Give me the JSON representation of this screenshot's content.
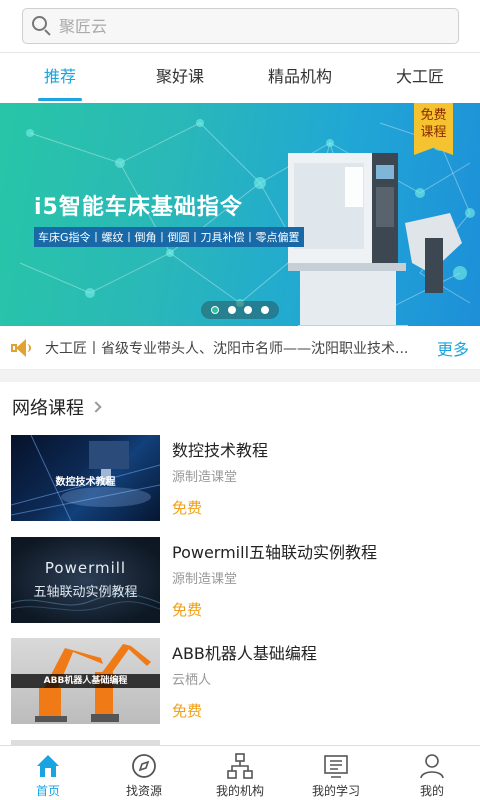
{
  "search": {
    "placeholder": "聚匠云"
  },
  "tabs": [
    {
      "label": "推荐",
      "active": true
    },
    {
      "label": "聚好课",
      "active": false
    },
    {
      "label": "精品机构",
      "active": false
    },
    {
      "label": "大工匠",
      "active": false
    }
  ],
  "banner": {
    "title": "i5智能车床基础指令",
    "subtitle": "车床G指令丨螺纹丨倒角丨倒圆丨刀具补偿丨零点偏置",
    "badge": "免费课程",
    "dots": 4,
    "active_dot": 0,
    "colors": {
      "start": "#28c6a7",
      "end": "#1e8fd8"
    }
  },
  "notice": {
    "icon": "speaker-icon",
    "text": "大工匠丨省级专业带头人、沈阳市名师——沈阳职业技术...",
    "more": "更多"
  },
  "section": {
    "title": "网络课程"
  },
  "courses": [
    {
      "name": "数控技术教程",
      "source": "源制造课堂",
      "price": "免费",
      "thumb_caption": "数控技术教程"
    },
    {
      "name": "Powermill五轴联动实例教程",
      "source": "源制造课堂",
      "price": "免费",
      "thumb_caption_1": "Powermill",
      "thumb_caption_2": "五轴联动实例教程"
    },
    {
      "name": "ABB机器人基础编程",
      "source": "云栖人",
      "price": "免费",
      "thumb_caption": "ABB机器人基础编程"
    }
  ],
  "bottom_nav": [
    {
      "label": "首页",
      "icon": "home-icon",
      "active": true
    },
    {
      "label": "找资源",
      "icon": "compass-icon",
      "active": false
    },
    {
      "label": "我的机构",
      "icon": "org-chart-icon",
      "active": false
    },
    {
      "label": "我的学习",
      "icon": "book-icon",
      "active": false
    },
    {
      "label": "我的",
      "icon": "user-icon",
      "active": false
    }
  ],
  "colors": {
    "accent": "#1aa4e0",
    "price": "#f0a017",
    "notice_icon": "#e0a231"
  }
}
